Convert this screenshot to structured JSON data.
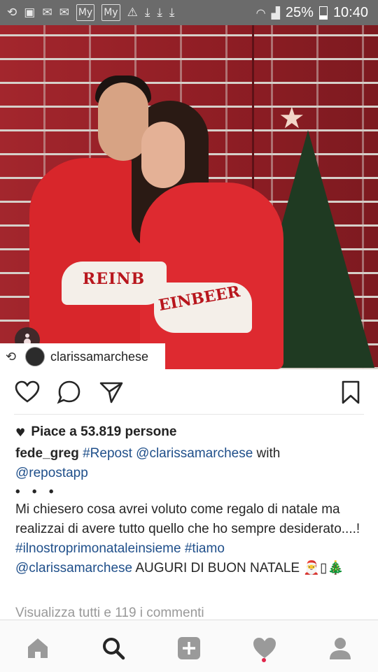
{
  "status_bar": {
    "left_icons": [
      "repost-notification-icon",
      "image-icon",
      "gmail-icon",
      "gmail-icon",
      "my-app-icon",
      "my-app-icon",
      "warning-icon",
      "download-icon",
      "download-icon",
      "download-icon"
    ],
    "my_label": "My",
    "battery_percent": "25%",
    "time": "10:40"
  },
  "post": {
    "repost_user": "clarissamarchese",
    "likes_text": "Piace a 53.819 persone",
    "author": "fede_greg",
    "caption_parts": {
      "tag1": "#Repost",
      "mention1": "@clarissamarchese",
      "with": " with",
      "mention2": "@repostapp",
      "dots": "• • •",
      "body": "Mi chiesero cosa avrei voluto come regalo di natale ma realizzai di avere tutto quello che ho sempre desiderato....!",
      "tag2": "#ilnostroprimonataleinsieme",
      "tag3": "#tiamo",
      "mention3": "@clarissamarchese",
      "closing": " AUGURI DI BUON NATALE 🎅▯🎄"
    },
    "view_all_comments": "Visualizza tutti e 119 i commenti"
  },
  "photo": {
    "sweater_text_left": "REINB",
    "sweater_text_right": "EINBEER"
  },
  "colors": {
    "status_bar": "#6b6b6b",
    "link": "#1f4f8a",
    "notification": "#e0264a"
  }
}
